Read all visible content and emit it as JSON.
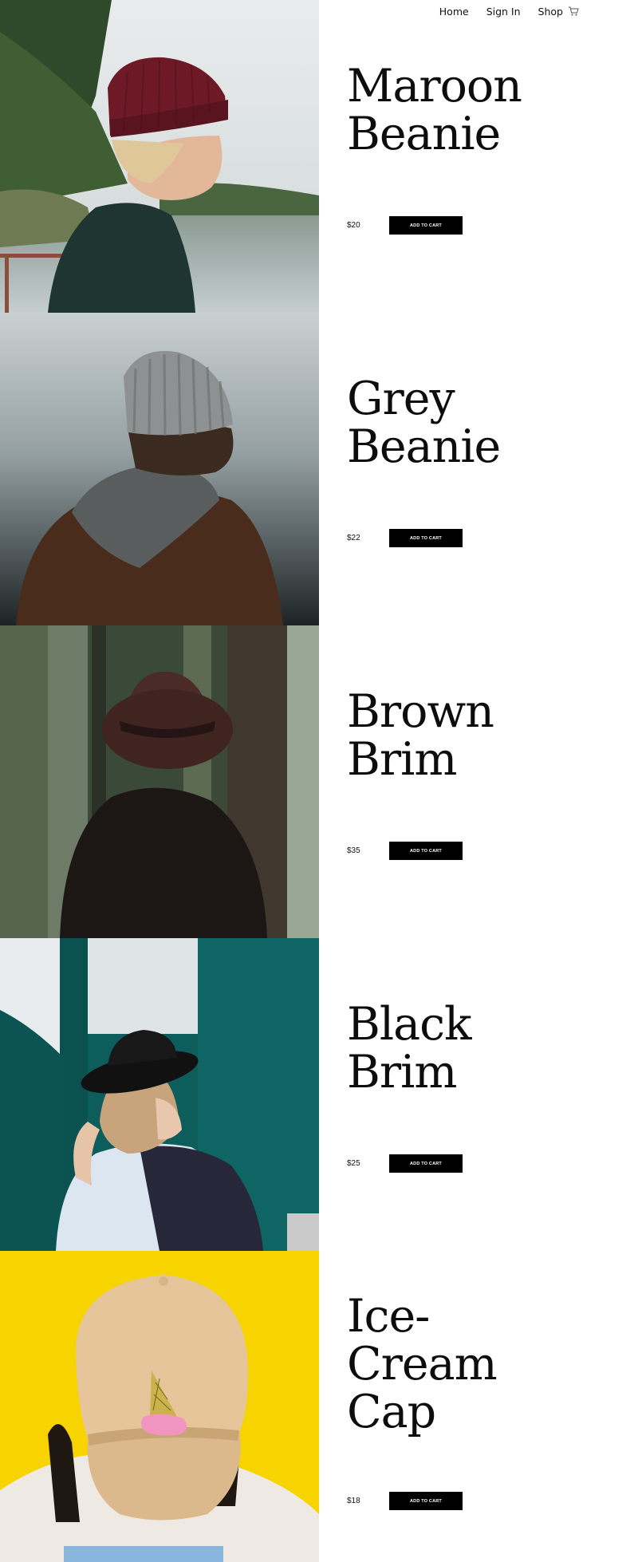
{
  "nav": {
    "home_label": "Home",
    "signin_label": "Sign In",
    "shop_label": "Shop",
    "cart_icon": "shopping-cart-icon"
  },
  "products": [
    {
      "name": "Maroon\nBeanie",
      "price": "$20",
      "button_label": "ADD TO CART"
    },
    {
      "name": "Grey\nBeanie",
      "price": "$22",
      "button_label": "ADD TO CART"
    },
    {
      "name": "Brown\nBrim",
      "price": "$35",
      "button_label": "ADD TO CART"
    },
    {
      "name": "Black\nBrim",
      "price": "$25",
      "button_label": "ADD TO CART"
    },
    {
      "name": "Ice-\nCream\nCap",
      "price": "$18",
      "button_label": "ADD TO CART"
    }
  ],
  "colors": {
    "button_bg": "#000000",
    "button_text": "#ffffff",
    "page_bg": "#ffffff",
    "text": "#111111"
  }
}
